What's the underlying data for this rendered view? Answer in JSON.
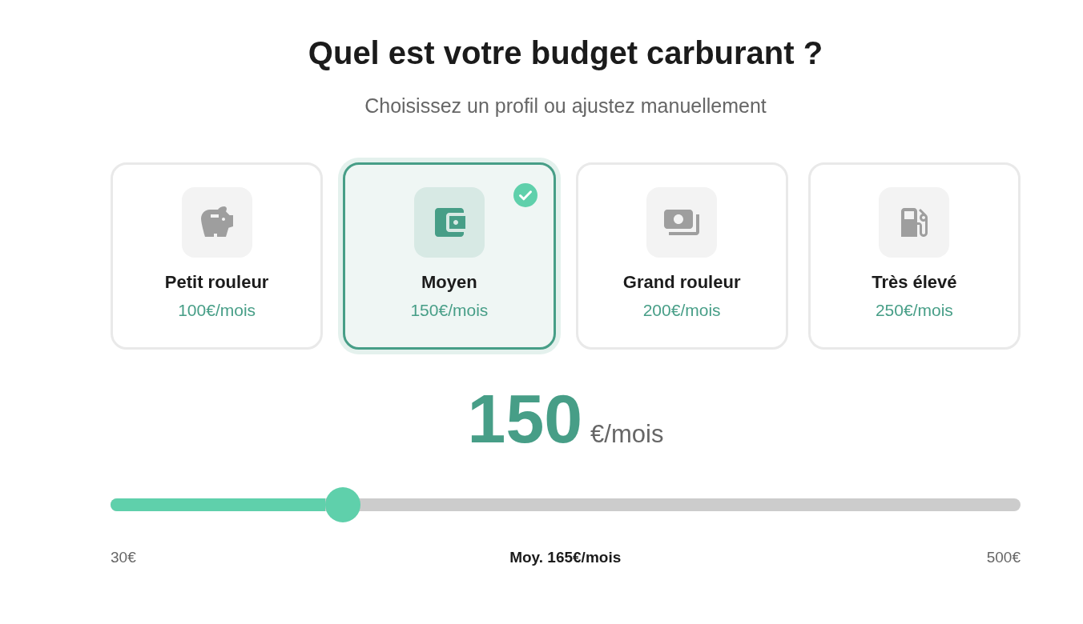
{
  "header": {
    "title": "Quel est votre budget carburant ?",
    "subtitle": "Choisissez un profil ou ajustez manuellement"
  },
  "profiles": [
    {
      "kind": "piggybank",
      "name": "Petit rouleur",
      "price": "100€/mois",
      "selected": false
    },
    {
      "kind": "wallet",
      "name": "Moyen",
      "price": "150€/mois",
      "selected": true
    },
    {
      "kind": "cash",
      "name": "Grand rouleur",
      "price": "200€/mois",
      "selected": false
    },
    {
      "kind": "fuel",
      "name": "Très élevé",
      "price": "250€/mois",
      "selected": false
    }
  ],
  "amount": {
    "value": "150",
    "unit": "€/mois"
  },
  "slider": {
    "level": 0.255,
    "min_label": "30€",
    "average_label": "Moy. 165€/mois",
    "max_label": "500€"
  }
}
